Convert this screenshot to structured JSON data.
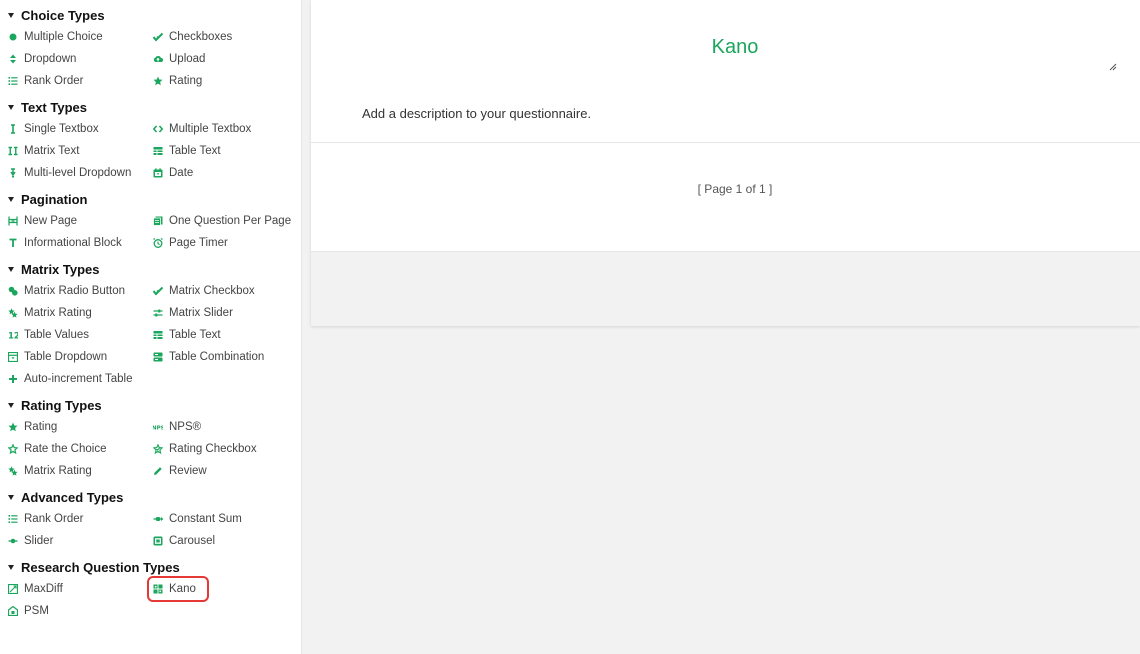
{
  "sidebar": {
    "sections": [
      {
        "title": "Choice Types",
        "items": [
          {
            "label": "Multiple Choice",
            "icon": "radio-dot-icon"
          },
          {
            "label": "Checkboxes",
            "icon": "double-check-icon"
          },
          {
            "label": "Dropdown",
            "icon": "sort-arrows-icon"
          },
          {
            "label": "Upload",
            "icon": "cloud-upload-icon"
          },
          {
            "label": "Rank Order",
            "icon": "list-icon"
          },
          {
            "label": "Rating",
            "icon": "star-icon"
          }
        ]
      },
      {
        "title": "Text Types",
        "items": [
          {
            "label": "Single Textbox",
            "icon": "text-cursor-icon"
          },
          {
            "label": "Multiple Textbox",
            "icon": "code-brackets-icon"
          },
          {
            "label": "Matrix Text",
            "icon": "matrix-text-icon"
          },
          {
            "label": "Table Text",
            "icon": "table-icon"
          },
          {
            "label": "Multi-level Dropdown",
            "icon": "multi-dropdown-icon"
          },
          {
            "label": "Date",
            "icon": "calendar-icon"
          }
        ]
      },
      {
        "title": "Pagination",
        "items": [
          {
            "label": "New Page",
            "icon": "page-break-icon"
          },
          {
            "label": "One Question Per Page",
            "icon": "pages-icon"
          },
          {
            "label": "Informational Block",
            "icon": "text-t-icon"
          },
          {
            "label": "Page Timer",
            "icon": "timer-icon"
          }
        ]
      },
      {
        "title": "Matrix Types",
        "items": [
          {
            "label": "Matrix Radio Button",
            "icon": "matrix-radio-icon"
          },
          {
            "label": "Matrix Checkbox",
            "icon": "double-check-icon"
          },
          {
            "label": "Matrix Rating",
            "icon": "matrix-star-icon"
          },
          {
            "label": "Matrix Slider",
            "icon": "slider-lines-icon"
          },
          {
            "label": "Table Values",
            "icon": "numbers-icon"
          },
          {
            "label": "Table Text",
            "icon": "table-icon"
          },
          {
            "label": "Table Dropdown",
            "icon": "table-dropdown-icon"
          },
          {
            "label": "Table Combination",
            "icon": "table-combination-icon"
          },
          {
            "label": "Auto-increment Table",
            "icon": "plus-icon"
          }
        ]
      },
      {
        "title": "Rating Types",
        "items": [
          {
            "label": "Rating",
            "icon": "star-icon"
          },
          {
            "label": "NPS®",
            "icon": "nps-icon"
          },
          {
            "label": "Rate the Choice",
            "icon": "star-outline-icon"
          },
          {
            "label": "Rating Checkbox",
            "icon": "star-check-icon"
          },
          {
            "label": "Matrix Rating",
            "icon": "matrix-star-icon"
          },
          {
            "label": "Review",
            "icon": "pencil-icon"
          }
        ]
      },
      {
        "title": "Advanced Types",
        "items": [
          {
            "label": "Rank Order",
            "icon": "list-icon"
          },
          {
            "label": "Constant Sum",
            "icon": "constant-sum-icon"
          },
          {
            "label": "Slider",
            "icon": "slider-icon"
          },
          {
            "label": "Carousel",
            "icon": "carousel-icon"
          }
        ]
      },
      {
        "title": "Research Question Types",
        "items": [
          {
            "label": "MaxDiff",
            "icon": "maxdiff-icon"
          },
          {
            "label": "Kano",
            "icon": "kano-icon",
            "highlighted": true
          },
          {
            "label": "PSM",
            "icon": "psm-icon"
          }
        ]
      }
    ]
  },
  "canvas": {
    "title": "Kano",
    "description": "Add a description to your questionnaire.",
    "page_indicator": "[ Page 1 of 1 ]"
  },
  "colors": {
    "accent": "#1aa65c",
    "highlight_outline": "#e53935"
  }
}
